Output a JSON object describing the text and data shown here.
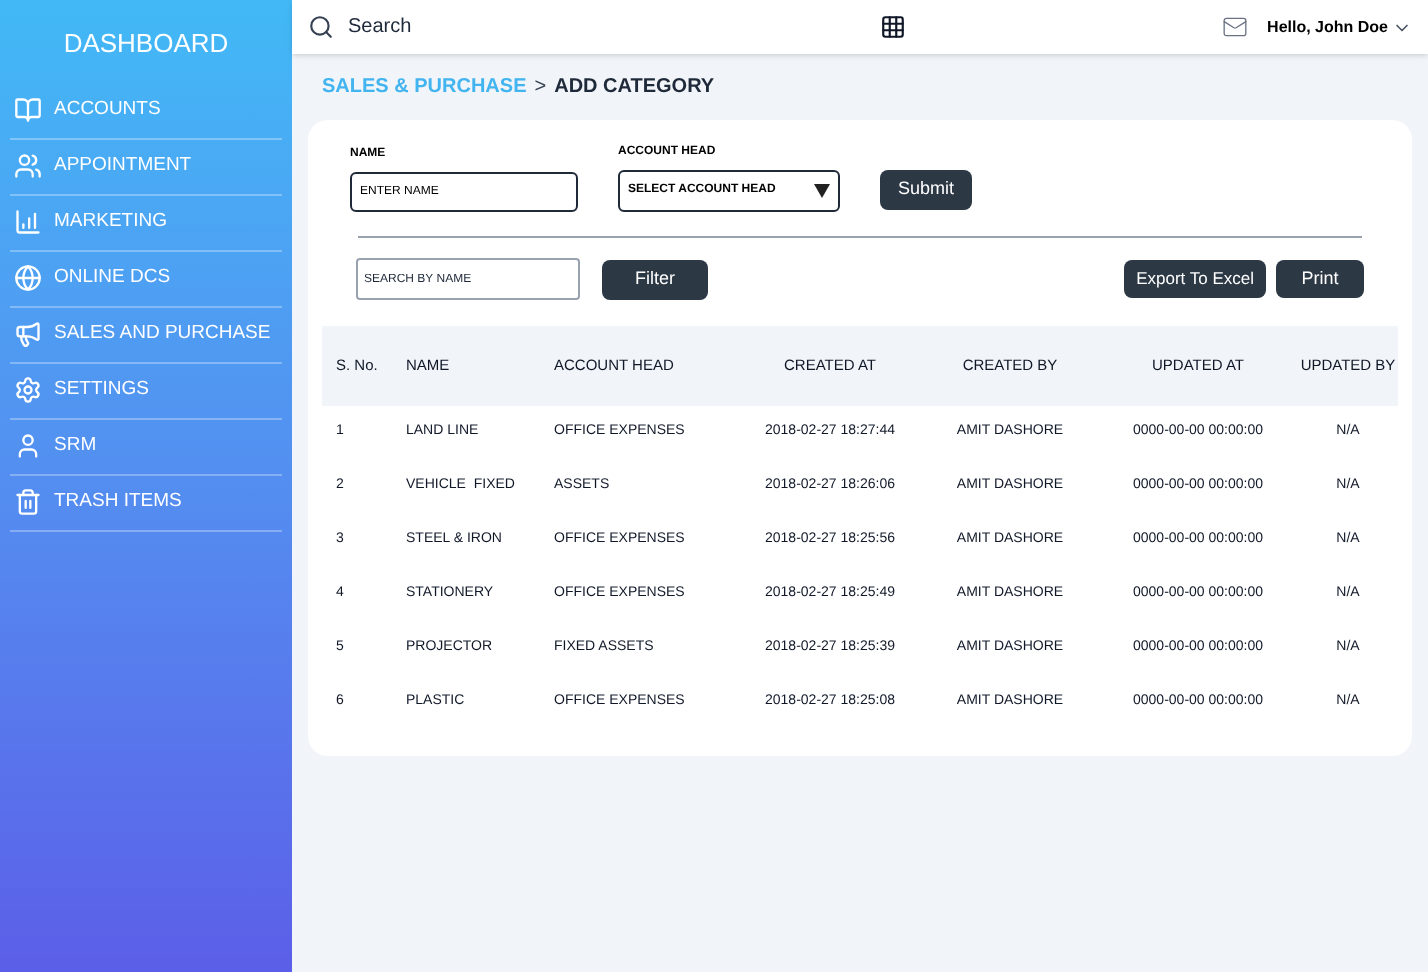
{
  "sidebar": {
    "title": "DASHBOARD",
    "items": [
      {
        "label": "ACCOUNTS"
      },
      {
        "label": "APPOINTMENT"
      },
      {
        "label": "MARKETING"
      },
      {
        "label": "ONLINE DCS"
      },
      {
        "label": "SALES AND PURCHASE"
      },
      {
        "label": "SETTINGS"
      },
      {
        "label": "SRM"
      },
      {
        "label": "TRASH ITEMS"
      }
    ]
  },
  "topbar": {
    "search_placeholder": "Search",
    "greeting": "Hello, John Doe"
  },
  "breadcrumb": {
    "parent": "SALES & PURCHASE",
    "separator": ">",
    "current": "ADD CATEGORY"
  },
  "form": {
    "name_label": "NAME",
    "name_placeholder": "ENTER NAME",
    "account_label": "ACCOUNT HEAD",
    "account_placeholder": "SELECT ACCOUNT HEAD",
    "submit": "Submit"
  },
  "filter": {
    "search_placeholder": "SEARCH BY NAME",
    "filter_button": "Filter",
    "export_button": "Export To Excel",
    "print_button": "Print"
  },
  "table": {
    "columns": [
      "S. No.",
      "NAME",
      "ACCOUNT HEAD",
      "CREATED AT",
      "CREATED BY",
      "UPDATED AT",
      "UPDATED BY"
    ],
    "rows": [
      [
        "1",
        "LAND LINE",
        "OFFICE EXPENSES",
        "2018-02-27 18:27:44",
        "AMIT DASHORE",
        "0000-00-00 00:00:00",
        "N/A"
      ],
      [
        "2",
        "VEHICLE  FIXED",
        "ASSETS",
        "2018-02-27 18:26:06",
        "AMIT DASHORE",
        "0000-00-00 00:00:00",
        "N/A"
      ],
      [
        "3",
        "STEEL & IRON",
        "OFFICE EXPENSES",
        "2018-02-27 18:25:56",
        "AMIT DASHORE",
        "0000-00-00 00:00:00",
        "N/A"
      ],
      [
        "4",
        "STATIONERY",
        "OFFICE EXPENSES",
        "2018-02-27 18:25:49",
        "AMIT DASHORE",
        "0000-00-00 00:00:00",
        "N/A"
      ],
      [
        "5",
        "PROJECTOR",
        "FIXED ASSETS",
        "2018-02-27 18:25:39",
        "AMIT DASHORE",
        "0000-00-00 00:00:00",
        "N/A"
      ],
      [
        "6",
        "PLASTIC",
        "OFFICE EXPENSES",
        "2018-02-27 18:25:08",
        "AMIT DASHORE",
        "0000-00-00 00:00:00",
        "N/A"
      ]
    ]
  }
}
